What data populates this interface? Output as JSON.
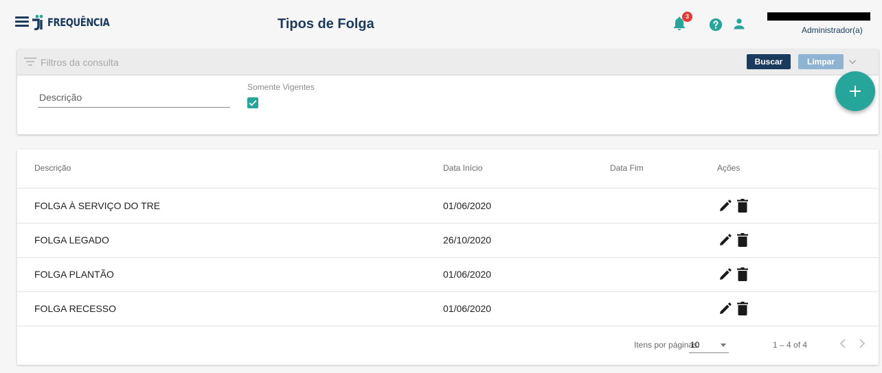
{
  "app": {
    "logo_text": "FREQUÊNCIA",
    "page_title": "Tipos de Folga",
    "notification_count": "3",
    "user_role": "Administrador(a)"
  },
  "filters": {
    "title": "Filtros da consulta",
    "search_label": "Buscar",
    "clear_label": "Limpar",
    "description_placeholder": "Descrição",
    "only_current_label": "Somente Vigentes",
    "only_current_checked": true
  },
  "table": {
    "columns": [
      "Descrição",
      "Data Início",
      "Data Fim",
      "Ações"
    ],
    "rows": [
      {
        "descricao": "FOLGA À SERVIÇO DO TRE",
        "data_inicio": "01/06/2020",
        "data_fim": ""
      },
      {
        "descricao": "FOLGA LEGADO",
        "data_inicio": "26/10/2020",
        "data_fim": ""
      },
      {
        "descricao": "FOLGA PLANTÃO",
        "data_inicio": "01/06/2020",
        "data_fim": ""
      },
      {
        "descricao": "FOLGA RECESSO",
        "data_inicio": "01/06/2020",
        "data_fim": ""
      }
    ]
  },
  "paginator": {
    "items_per_page_label": "Itens por páginas:",
    "items_per_page": "10",
    "range": "1 – 4 of 4"
  },
  "icons": {
    "menu": "menu-icon",
    "bell": "bell-icon",
    "help": "help-circle-icon",
    "person": "person-icon",
    "filter": "filter-list-icon",
    "expand": "chevron-down-icon",
    "add": "plus-icon",
    "edit": "pencil-icon",
    "delete": "trash-icon",
    "prev": "chevron-left-icon",
    "next": "chevron-right-icon"
  },
  "colors": {
    "primary": "#1b3b5e",
    "accent": "#26a69a",
    "badge": "#e53935",
    "clear_button": "#8fb3d3"
  }
}
